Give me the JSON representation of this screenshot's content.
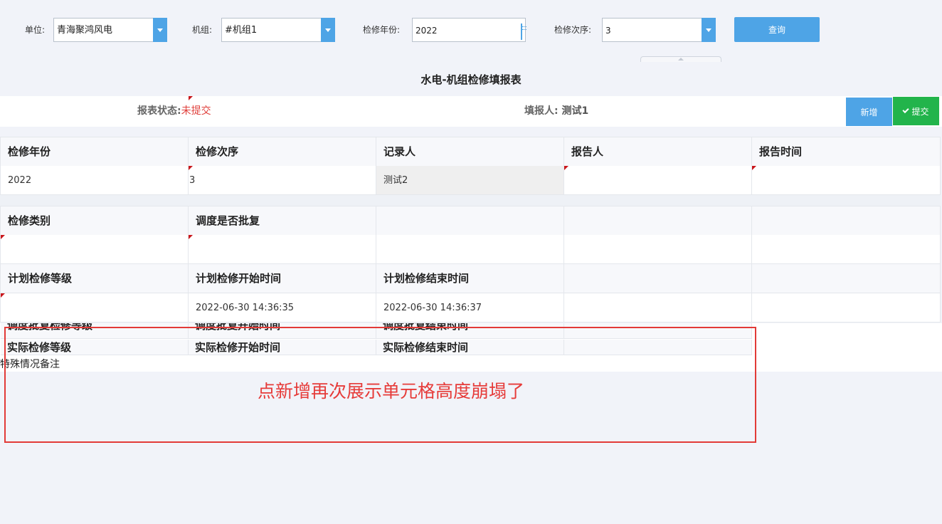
{
  "filters": {
    "unit_label": "单位:",
    "unit_value": "青海聚鸿风电",
    "unit_label_colon_note": "",
    "group_label": "机组:",
    "group_value": "#机组1",
    "year_label": "检修年份:",
    "year_value": "2022",
    "seq_label": "检修次序:",
    "seq_value": "3",
    "query_label": "查询"
  },
  "report": {
    "title": "水电-机组检修填报表",
    "status_label": "报表状态:",
    "status_value": "未提交",
    "reporter_label": "填报人:",
    "reporter_value": "测试1",
    "add_label": "新增",
    "submit_label": "提交"
  },
  "rows": {
    "r1_headers": [
      "检修年份",
      "检修次序",
      "记录人",
      "报告人",
      "报告时间"
    ],
    "r1_values": [
      "2022",
      "3",
      "测试2",
      "",
      ""
    ],
    "r2_headers": [
      "检修类别",
      "调度是否批复",
      "",
      "",
      ""
    ],
    "r3_headers": [
      "计划检修等级",
      "计划检修开始时间",
      "计划检修结束时间",
      "",
      ""
    ],
    "r3_values": [
      "",
      "2022-06-30 14:36:35",
      "2022-06-30 14:36:37",
      "",
      ""
    ],
    "collapsed_1": [
      "调度批复检修等级",
      "调度批复开始时间",
      "调度批复结束时间",
      ""
    ],
    "collapsed_2": [
      "实际检修等级",
      "实际检修开始时间",
      "实际检修结束时间",
      ""
    ],
    "remark_label": "特殊情况备注"
  },
  "annotation": {
    "text": "点新增再次展示单元格高度崩塌了",
    "color": "#e63b39"
  },
  "colors": {
    "accent": "#4ea4e6",
    "submit": "#22b44b",
    "status_red": "#e0403c"
  }
}
